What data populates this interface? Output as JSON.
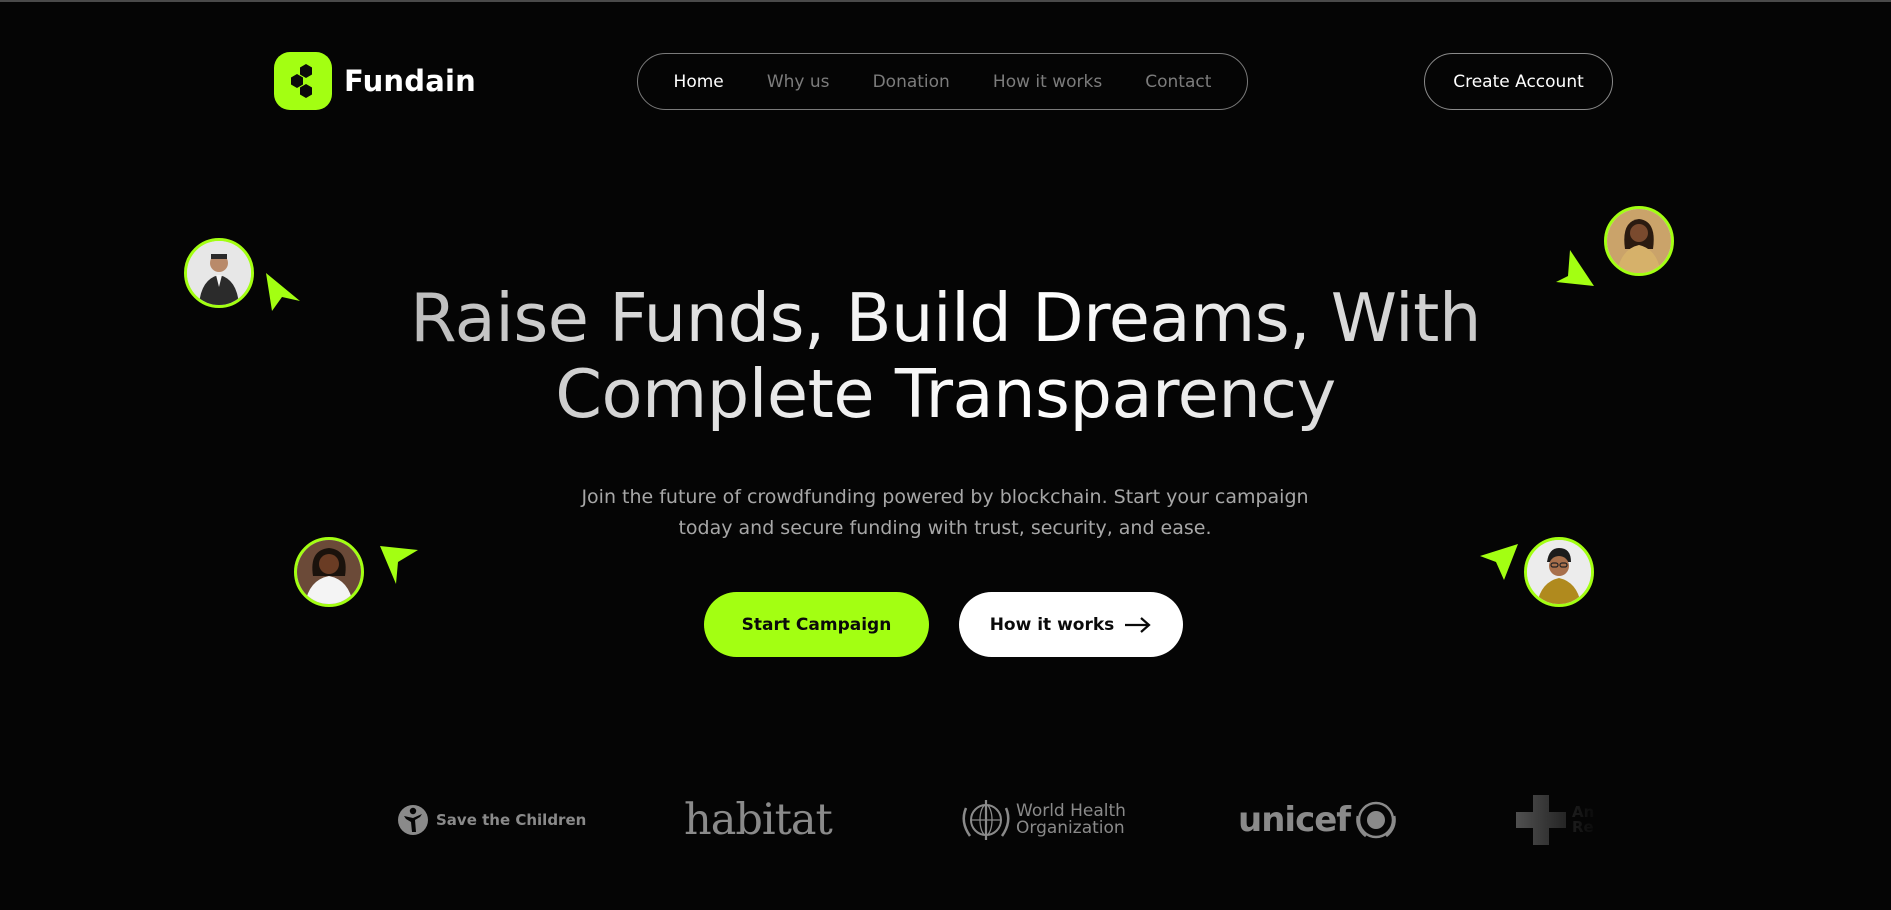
{
  "brand": {
    "name": "Fundain",
    "accent": "#a3ff12"
  },
  "nav": {
    "items": [
      {
        "label": "Home",
        "active": true
      },
      {
        "label": "Why us",
        "active": false
      },
      {
        "label": "Donation",
        "active": false
      },
      {
        "label": "How it works",
        "active": false
      },
      {
        "label": "Contact",
        "active": false
      }
    ]
  },
  "header": {
    "create_account": "Create Account"
  },
  "hero": {
    "title_line1": "Raise Funds, Build Dreams, With",
    "title_line2": "Complete Transparency",
    "subtitle_line1": "Join the future of crowdfunding powered by blockchain. Start your campaign",
    "subtitle_line2": "today and secure funding with trust, security, and ease.",
    "primary_cta": "Start Campaign",
    "secondary_cta": "How it works"
  },
  "partners": {
    "save_the_children": "Save the Children",
    "habitat": "habitat",
    "who_line1": "World Health",
    "who_line2": "Organization",
    "unicef": "unicef",
    "american_red_cross_partial_1": "An",
    "american_red_cross_partial_2": "Re"
  },
  "icons": {
    "logo": "hexagon-cluster-icon",
    "arrow": "arrow-right-icon",
    "pointer": "cursor-pointer-icon"
  }
}
